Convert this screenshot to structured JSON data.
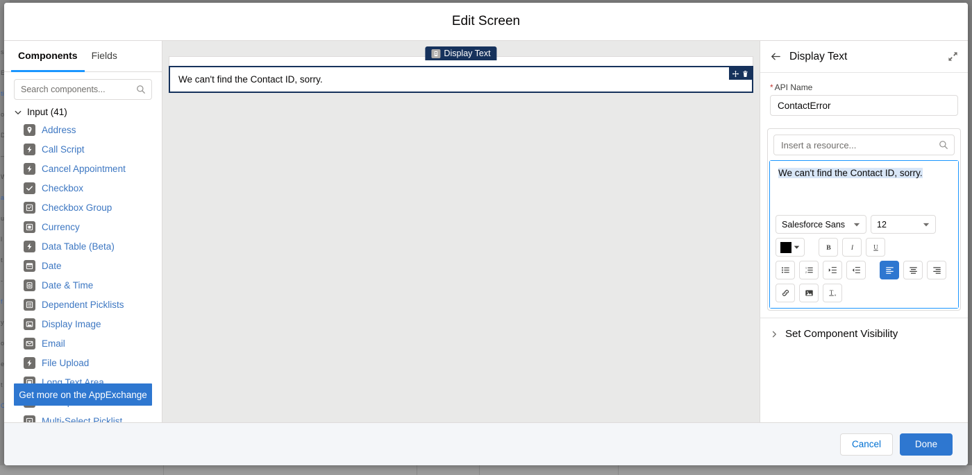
{
  "modal": {
    "title": "Edit Screen"
  },
  "backdrop": {
    "fragments": [
      "s",
      "E",
      "ti",
      "o",
      "D",
      "—",
      "W",
      "a",
      "u",
      "l",
      "t",
      "-",
      "f",
      "y",
      "o",
      "e",
      "t",
      "C"
    ]
  },
  "left_panel": {
    "tabs": [
      {
        "label": "Components",
        "active": true
      },
      {
        "label": "Fields",
        "active": false
      }
    ],
    "search": {
      "placeholder": "Search components...",
      "value": "",
      "icon": "search-icon"
    },
    "group": {
      "label": "Input (41)",
      "icon": "chevron-down-icon",
      "expanded": true
    },
    "components": [
      {
        "label": "Address",
        "icon": "location-pin-icon"
      },
      {
        "label": "Call Script",
        "icon": "lightning-bolt-icon"
      },
      {
        "label": "Cancel Appointment",
        "icon": "lightning-bolt-icon"
      },
      {
        "label": "Checkbox",
        "icon": "check-icon"
      },
      {
        "label": "Checkbox Group",
        "icon": "checkbox-group-icon"
      },
      {
        "label": "Currency",
        "icon": "currency-icon"
      },
      {
        "label": "Data Table (Beta)",
        "icon": "lightning-bolt-icon"
      },
      {
        "label": "Date",
        "icon": "calendar-icon"
      },
      {
        "label": "Date & Time",
        "icon": "clock-calendar-icon"
      },
      {
        "label": "Dependent Picklists",
        "icon": "list-icon"
      },
      {
        "label": "Display Image",
        "icon": "image-icon"
      },
      {
        "label": "Email",
        "icon": "envelope-icon"
      },
      {
        "label": "File Upload",
        "icon": "lightning-bolt-icon"
      },
      {
        "label": "Long Text Area",
        "icon": "text-area-icon"
      },
      {
        "label": "Lookup",
        "icon": "lookup-icon"
      },
      {
        "label": "Multi-Select Picklist",
        "icon": "picklist-icon"
      }
    ],
    "appexchange_button": "Get more on the AppExchange"
  },
  "canvas": {
    "component_tab": {
      "label": "Display Text",
      "icon": "display-text-icon"
    },
    "selected_component": {
      "text": "We can't find the Contact ID, sorry.",
      "actions": [
        {
          "name": "move-icon"
        },
        {
          "name": "delete-icon"
        }
      ]
    }
  },
  "right_panel": {
    "back_icon": "arrow-left-icon",
    "title": "Display Text",
    "expand_icon": "expand-icon",
    "api_name": {
      "label": "API Name",
      "required_marker": "*",
      "value": "ContactError"
    },
    "resource_search": {
      "placeholder": "Insert a resource...",
      "value": "",
      "icon": "search-icon"
    },
    "editor": {
      "content": "We can't find the Contact ID, sorry.",
      "selected": true
    },
    "toolbar": {
      "font_family": "Salesforce Sans",
      "font_size": "12",
      "text_color": "#000000",
      "buttons": [
        {
          "name": "text-color-picker",
          "active": false
        },
        {
          "name": "bold-button",
          "label": "B",
          "active": false
        },
        {
          "name": "italic-button",
          "label": "I",
          "active": false
        },
        {
          "name": "underline-button",
          "label": "U",
          "active": false
        },
        {
          "name": "bulleted-list-button",
          "active": false
        },
        {
          "name": "numbered-list-button",
          "active": false
        },
        {
          "name": "indent-button",
          "active": false
        },
        {
          "name": "outdent-button",
          "active": false
        },
        {
          "name": "align-left-button",
          "active": true
        },
        {
          "name": "align-center-button",
          "active": false
        },
        {
          "name": "align-right-button",
          "active": false
        },
        {
          "name": "link-button",
          "active": false
        },
        {
          "name": "image-button",
          "active": false
        },
        {
          "name": "remove-formatting-button",
          "active": false
        }
      ]
    },
    "visibility_section": {
      "label": "Set Component Visibility",
      "icon": "chevron-right-icon",
      "expanded": false
    }
  },
  "footer": {
    "cancel_label": "Cancel",
    "done_label": "Done"
  },
  "colors": {
    "brand_blue": "#2e77d0",
    "link_blue": "#3d77c2",
    "dark_navy": "#16325c",
    "accent_focus": "#1b96ff",
    "required_red": "#c23934",
    "selection_highlight": "#d8e6f7"
  }
}
